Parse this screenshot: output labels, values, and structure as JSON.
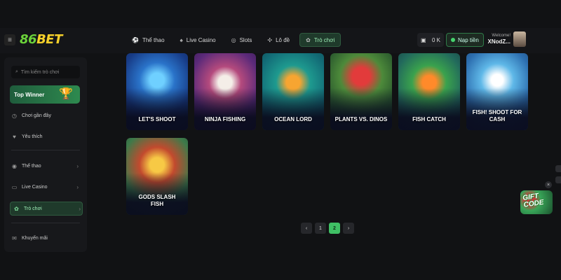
{
  "header": {
    "logo_number": "8",
    "logo_text": "BET",
    "nav": [
      {
        "icon": "ball-icon",
        "label": "Thể thao"
      },
      {
        "icon": "card-icon",
        "label": "Live Casino"
      },
      {
        "icon": "slot-icon",
        "label": "Slots"
      },
      {
        "icon": "dice-icon",
        "label": "Lô đề"
      },
      {
        "icon": "gamepad-icon",
        "label": "Trò chơi"
      }
    ],
    "balance": "0 K",
    "deposit_label": "Nạp tiền",
    "welcome_label": "Welcome!",
    "username": "XNodZ..."
  },
  "sidebar": {
    "search_placeholder": "Tìm kiếm trò chơi",
    "top_winner": "Top Winner",
    "items": [
      {
        "icon": "clock-icon",
        "label": "Chơi gần đây"
      },
      {
        "icon": "heart-icon",
        "label": "Yêu thích"
      },
      {
        "icon": "ball-icon",
        "label": "Thể thao"
      },
      {
        "icon": "card-icon",
        "label": "Live Casino"
      },
      {
        "icon": "gamepad-icon",
        "label": "Trò chơi"
      },
      {
        "icon": "gift-icon",
        "label": "Khuyến mãi"
      }
    ]
  },
  "games": [
    {
      "title": "LET'S SHOOT"
    },
    {
      "title": "NINJA FISHING"
    },
    {
      "title": "OCEAN LORD"
    },
    {
      "title": "PLANTS VS. DINOS"
    },
    {
      "title": "FISH CATCH"
    },
    {
      "title": "FISH! SHOOT FOR CASH"
    },
    {
      "title": "GODS SLASH FISH"
    }
  ],
  "pagination": {
    "prev": "‹",
    "pages": [
      "1",
      "2"
    ],
    "current": "2",
    "next": "›"
  },
  "promo": {
    "gift_text": "GIFT CODE"
  },
  "colors": {
    "accent": "#3fbf64",
    "brand_yellow": "#f5d02a",
    "background": "#111214"
  }
}
